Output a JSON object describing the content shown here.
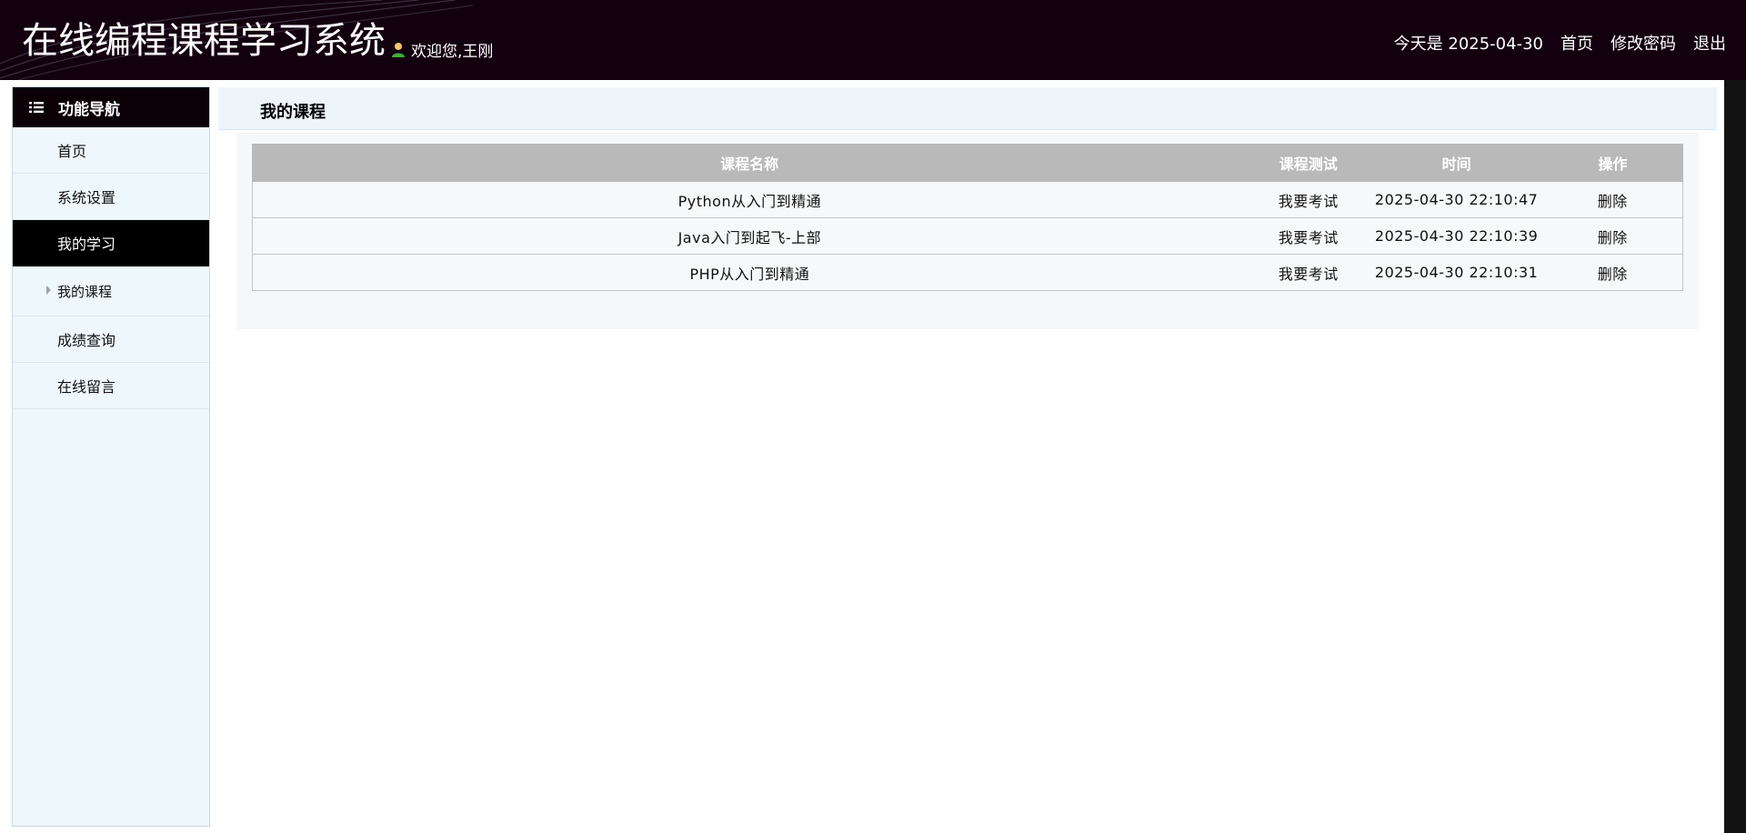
{
  "header": {
    "app_title": "在线编程课程学习系统",
    "welcome": "欢迎您,王刚",
    "date_text": "今天是 2025-04-30",
    "nav": {
      "home": "首页",
      "change_password": "修改密码",
      "logout": "退出"
    },
    "bg_color": "#13000f"
  },
  "sidebar": {
    "heading": "功能导航",
    "items": [
      {
        "label": "首页"
      },
      {
        "label": "系统设置"
      },
      {
        "label": "我的学习",
        "active": true
      },
      {
        "label": "我的课程"
      },
      {
        "label": "成绩查询"
      },
      {
        "label": "在线留言"
      }
    ]
  },
  "main": {
    "title": "我的课程",
    "table": {
      "columns": [
        "课程名称",
        "课程测试",
        "时间",
        "操作"
      ],
      "rows": [
        {
          "name": "Python从入门到精通",
          "test": "我要考试",
          "time": "2025-04-30 22:10:47",
          "action": "删除"
        },
        {
          "name": "Java入门到起飞-上部",
          "test": "我要考试",
          "time": "2025-04-30 22:10:39",
          "action": "删除"
        },
        {
          "name": "PHP从入门到精通",
          "test": "我要考试",
          "time": "2025-04-30 22:10:31",
          "action": "删除"
        }
      ]
    }
  }
}
